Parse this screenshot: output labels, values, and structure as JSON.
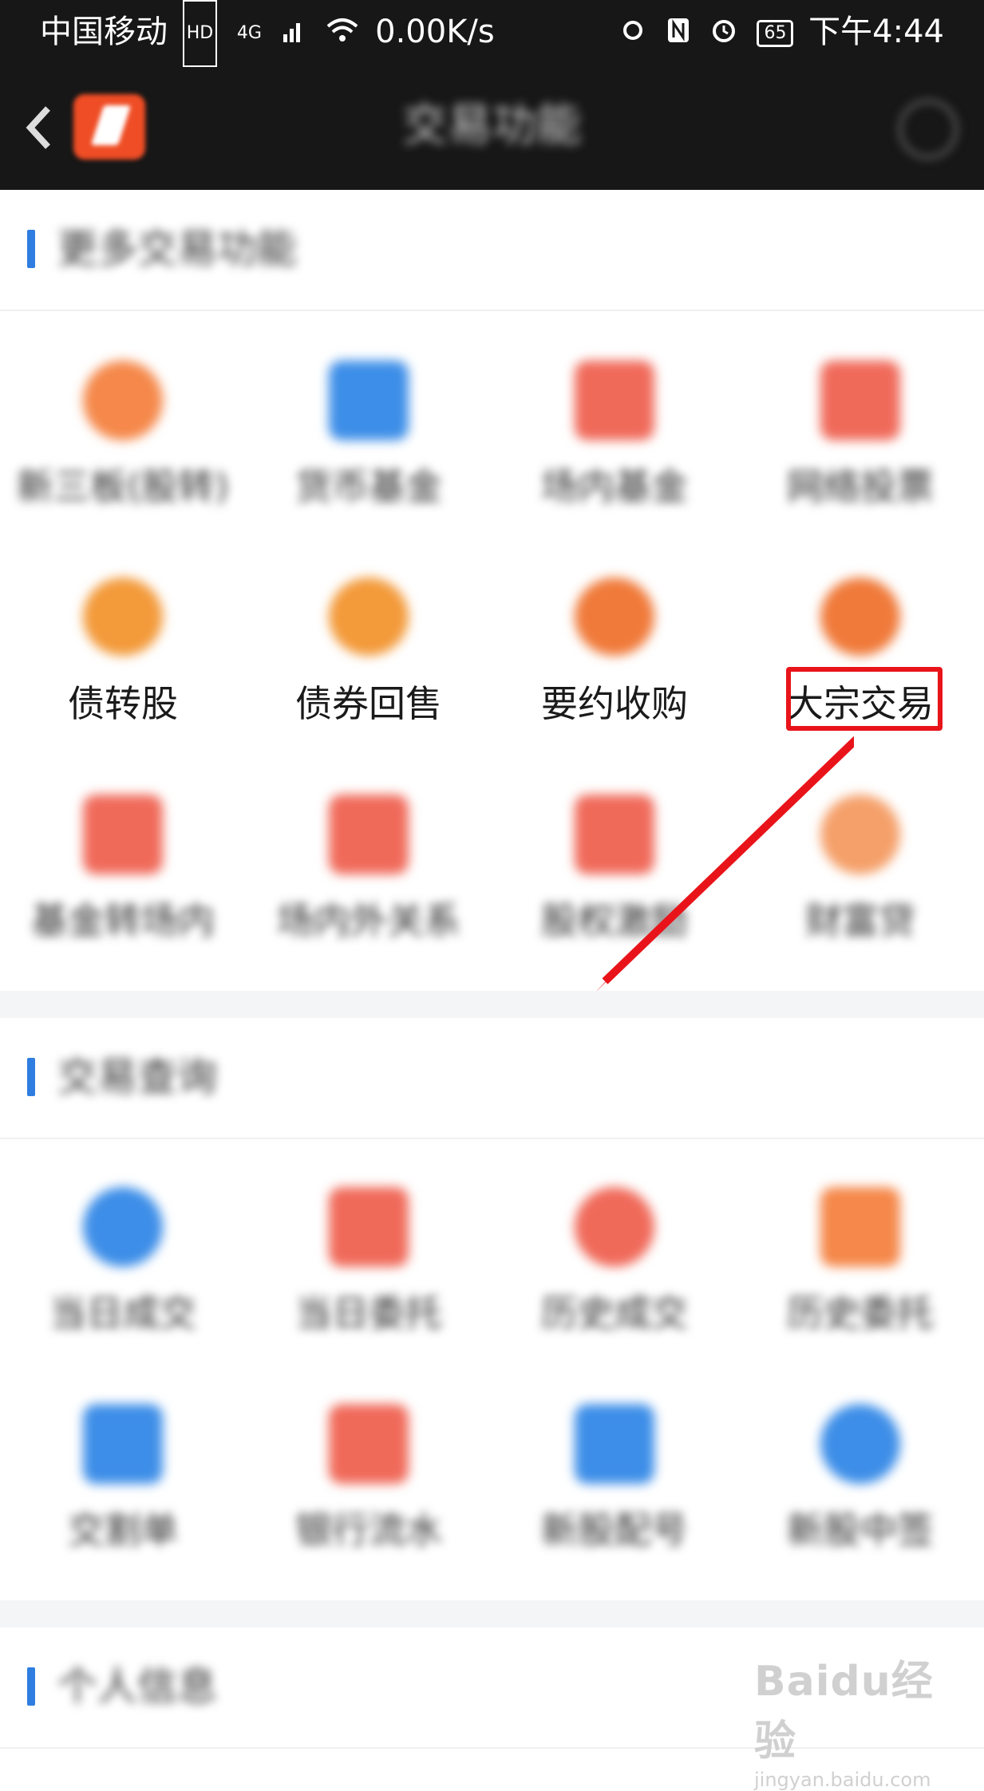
{
  "status_bar": {
    "carrier": "中国移动",
    "network": "4G",
    "speed": "0.00K/s",
    "battery": "65",
    "time": "下午4:44"
  },
  "header": {
    "back_icon": "chevron-left-icon",
    "title": "交易功能",
    "settings_icon": "gear-icon"
  },
  "sections": {
    "more": {
      "title": "更多交易功能",
      "items": [
        {
          "label": "新三板(股转)",
          "icon": "circle-icon",
          "color": "#f5884a"
        },
        {
          "label": "货币基金",
          "icon": "dollar-doc-icon",
          "color": "#3d8ee8"
        },
        {
          "label": "场内基金",
          "icon": "chart-doc-icon",
          "color": "#f06a5a"
        },
        {
          "label": "网络投票",
          "icon": "vote-doc-icon",
          "color": "#f06a5a"
        },
        {
          "label": "债转股",
          "icon": "coin-icon",
          "color": "#f39a3a"
        },
        {
          "label": "债券回售",
          "icon": "coin-icon",
          "color": "#f39a3a"
        },
        {
          "label": "要约收购",
          "icon": "coin-icon",
          "color": "#f07a3a"
        },
        {
          "label": "大宗交易",
          "icon": "coin-icon",
          "color": "#f07a3a"
        },
        {
          "label": "基金转场内",
          "icon": "exchange-doc-icon",
          "color": "#f06a5a"
        },
        {
          "label": "场内外关系",
          "icon": "exchange-doc-icon",
          "color": "#f06a5a"
        },
        {
          "label": "股权激励",
          "icon": "gift-icon",
          "color": "#f06a5a"
        },
        {
          "label": "财富贷",
          "icon": "target-icon",
          "color": "#f5a06a"
        }
      ]
    },
    "query": {
      "title": "交易查询",
      "items": [
        {
          "label": "当日成交",
          "icon": "pie-icon",
          "color": "#3d8ee8"
        },
        {
          "label": "当日委托",
          "icon": "chart-doc-icon",
          "color": "#f06a5a"
        },
        {
          "label": "历史成交",
          "icon": "pie-icon",
          "color": "#f06a5a"
        },
        {
          "label": "历史委托",
          "icon": "chart-doc-icon",
          "color": "#f5884a"
        },
        {
          "label": "交割单",
          "icon": "receipt-icon",
          "color": "#3d8ee8"
        },
        {
          "label": "银行流水",
          "icon": "bank-doc-icon",
          "color": "#f06a5a"
        },
        {
          "label": "新股配号",
          "icon": "candle-icon",
          "color": "#3d8ee8"
        },
        {
          "label": "新股中签",
          "icon": "medal-icon",
          "color": "#3d8ee8"
        }
      ]
    },
    "personal": {
      "title": "个人信息"
    }
  },
  "annotation": {
    "highlight_color": "#e8141a"
  },
  "watermark": {
    "main": "Baidu经验",
    "sub": "jingyan.baidu.com"
  }
}
